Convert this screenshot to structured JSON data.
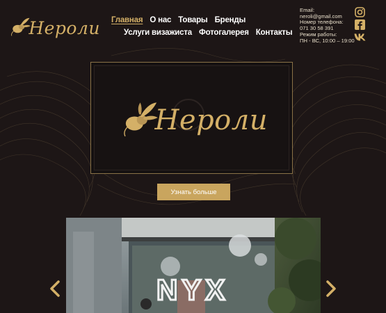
{
  "brand": {
    "name": "Нероли"
  },
  "nav": {
    "row1": [
      {
        "label": "Главная",
        "active": true
      },
      {
        "label": "О нас"
      },
      {
        "label": "Товары"
      },
      {
        "label": "Бренды"
      }
    ],
    "row2": [
      {
        "label": "Услуги визажиста"
      },
      {
        "label": "Фотогалерея"
      },
      {
        "label": "Контакты"
      }
    ]
  },
  "contacts": {
    "email_label": "Email:",
    "email": "neroli@gmail.com",
    "phone_label": "Номер телефона:",
    "phone": "071 30 58 391",
    "hours_label": "Режим работы:",
    "hours": "ПН - ВС, 10:00 – 19:00"
  },
  "socials": [
    {
      "icon": "instagram-icon"
    },
    {
      "icon": "facebook-icon"
    },
    {
      "icon": "vk-icon"
    }
  ],
  "hero": {
    "logo_text": "Нероли",
    "button_label": "Узнать больше"
  },
  "gallery": {
    "sign_text": "NYX"
  },
  "colors": {
    "background": "#1d1616",
    "accent_gold": "#d4b067",
    "button_gold": "#c9a55e"
  }
}
